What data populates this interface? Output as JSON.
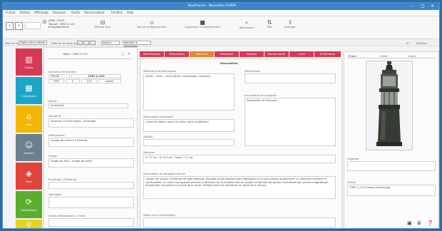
{
  "window": {
    "title": "Navifrance · Nouvelles CHIRM"
  },
  "menu": [
    "Fichier",
    "Édition",
    "Affichage",
    "Dossiers",
    "Outils",
    "Personnaliser",
    "Fenêtre",
    "Aide"
  ],
  "toolbar": {
    "record_info_lines": [
      "4950 / 3022",
      "Trouvé : 1987.0.123",
      "Enregistrement"
    ],
    "buttons": [
      {
        "label": "Afficher tout"
      },
      {
        "label": "Nouvel enregistrement"
      },
      {
        "label": "Supprimer l'enregistrement"
      },
      {
        "label": "Rechercher"
      },
      {
        "label": "Trier"
      },
      {
        "label": "Partager"
      }
    ]
  },
  "filterbar": {
    "layout_label": "Mise en page :",
    "layout_value": "Objets (fiche détail)",
    "view_label": "Afficher en tant que :",
    "mode_value": "Formulaire",
    "preview_label": "Aperçu",
    "edit_layout": "Modifier la disposition",
    "format_label": "A²",
    "toolbar_edit": "Modifier"
  },
  "sidebar": {
    "items": [
      {
        "label": "Objets",
        "icon": "museum-icon",
        "color": "#d63955"
      },
      {
        "label": "Collections",
        "icon": "boxes-icon",
        "color": "#1aa6c9"
      },
      {
        "label": "Lieux",
        "icon": "house-icon",
        "color": "#f2b705"
      },
      {
        "label": "Acteurs",
        "icon": "person-icon",
        "color": "#6b7f8e"
      },
      {
        "label": "Mots",
        "icon": "tag-icon",
        "color": "#e0453b"
      },
      {
        "label": "Statistiques",
        "icon": "cycle-icon",
        "color": "#5aae2e"
      },
      {
        "label": "Recherche",
        "icon": "magnifier-icon",
        "color": "#e6d21a"
      }
    ]
  },
  "record": {
    "header": "Objet : 1987.0.123",
    "identifier_label": "Numéro d'inventaire",
    "prefix_value": "PRCDE",
    "number_value": "1987.0.123",
    "year_value": "1987",
    "part_values": [
      "0",
      "123",
      "partie"
    ],
    "status_label": "Statut",
    "status_value": "Inventorié",
    "domain_label": "Domaine",
    "domain_value": "Sciences et techniques ; éclairage",
    "designation_label": "Désignation",
    "designation_value": "Lampe de mineur à flamme",
    "image_label": "Image",
    "image_value": "Image de face ; image de profil",
    "linked_objects_label": "Ensemble / Partie de",
    "linked_value": "",
    "typology_label": "Typologie",
    "typology_value": "",
    "other_designations_label": "Autres désignations / Titres"
  },
  "tabs": [
    {
      "label": "Identification",
      "color": "#d63955"
    },
    {
      "label": "Description",
      "color": "#d63955"
    },
    {
      "label": "Matériau",
      "color": "#e4862a"
    },
    {
      "label": "Historique",
      "color": "#d63955"
    },
    {
      "label": "Gestion",
      "color": "#d63955"
    },
    {
      "label": "Mouvements",
      "color": "#d63955"
    },
    {
      "label": "Liens",
      "color": "#d63955"
    },
    {
      "label": "Multimédia",
      "color": "#d63955"
    }
  ],
  "description": {
    "section_title": "Description",
    "materials_label": "Matériaux et techniques",
    "materials_value": "Laiton ; acier ; verre (fonte, estampage, soudure)",
    "dimensions_label": "Dimensions",
    "dimensions_value": "",
    "inscriptions_label": "Inscriptions et marques",
    "inscriptions_value": "Estampille du fabricant",
    "state_label": "État",
    "state_value": "",
    "technique_label": "Description technique",
    "technique_value": "Corps en laiton, tamis en acier, verre protecteur",
    "detail_label": "Détails",
    "detail_value": "",
    "measures_label": "Mesures",
    "measures_value": "H. 27 cm ; D. 8,5 cm ; Poids : 1,2 kg",
    "summary_label": "Description en langage naturel",
    "summary_value": "Lampe de mineur à flamme de type Marsaut, équipée d'une double toile métallique et d'une cuirasse protectrice. Le réservoir contient le combustible. Le verre transparent permet la diffusion de la lumière tout en isolant la flamme du grisou. Fermeture par serrure magnétique empêchant l'ouverture au fond de la mine. Utilisée dans les houillères du Nord de la France.",
    "notes_label": "Notes sur la description"
  },
  "preview": {
    "tabs": [
      "Photo",
      "Vidéo",
      "Audio"
    ],
    "legend_label": "Légende",
    "file_label": "Fichier",
    "file_value": "1987_0_123_lampe_mineur.jpg",
    "colors": {
      "accent": "#d63955"
    }
  }
}
